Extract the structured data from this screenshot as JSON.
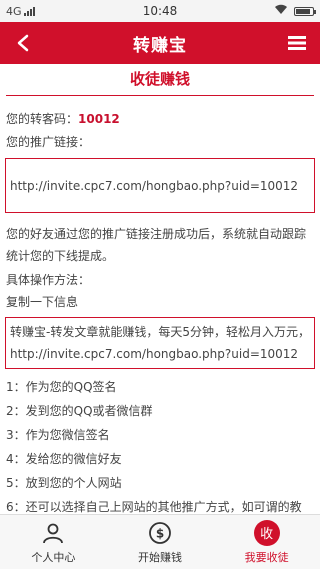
{
  "status_bar": {
    "network": "4G",
    "time": "10:48",
    "battery_level": 0.85
  },
  "header": {
    "title": "转赚宝"
  },
  "page_heading": "收徒赚钱",
  "invite": {
    "code_label": "您的转客码：",
    "code_value": "10012",
    "link_label": "您的推广链接：",
    "link_url": "http://invite.cpc7.com/hongbao.php?uid=10012"
  },
  "description": "您的好友通过您的推广链接注册成功后，系统就自动跟踪统计您的下线提成。",
  "ops_title": "具体操作方法：",
  "copy_title": "复制一下信息",
  "share_text": "转赚宝-转发文章就能赚钱，每天5分钟，轻松月入万元，http://invite.cpc7.com/hongbao.php?uid=10012",
  "steps": [
    "1：作为您的QQ签名",
    "2：发到您的QQ或者微信群",
    "3：作为您微信签名",
    "4：发给您的微信好友",
    "5：放到您的个人网站",
    "6：还可以选择自己上网站的其他推广方式，如可谓的教"
  ],
  "tabs": [
    {
      "label": "个人中心",
      "icon": "person-icon"
    },
    {
      "label": "开始赚钱",
      "icon": "money-icon"
    },
    {
      "label": "我要收徒",
      "icon": "recruit-icon",
      "badge": "收"
    }
  ],
  "colors": {
    "brand_red": "#d0102b",
    "tab_bar_bg": "#f7f7f7"
  }
}
